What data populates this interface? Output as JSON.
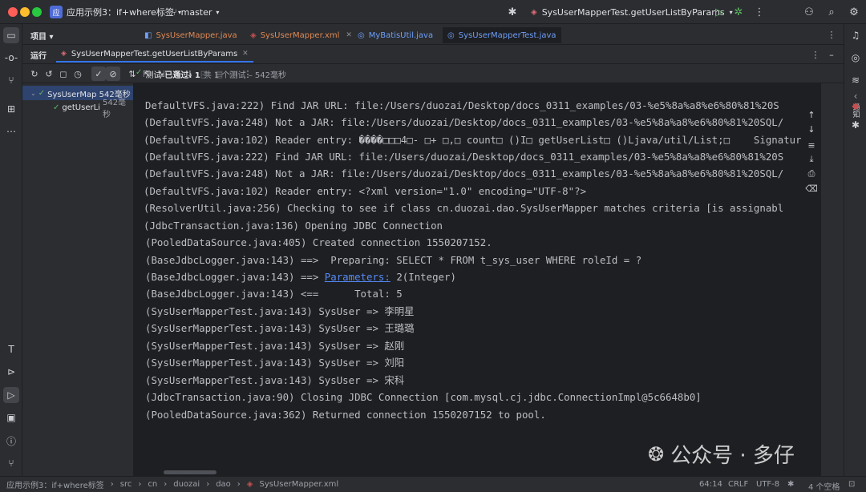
{
  "titlebar": {
    "project_badge": "应",
    "project": "应用示例3：if+where标签",
    "branch": "master",
    "run_config": "SysUserMapperTest.getUserListByParams"
  },
  "editor_tabs": {
    "project_label": "项目",
    "tabs": [
      {
        "label": "SysUserMapper.java",
        "color": "#e08855"
      },
      {
        "label": "SysUserMapper.xml",
        "color": "#e08855"
      },
      {
        "label": "MyBatisUtil.java",
        "color": "#6f9ef8"
      },
      {
        "label": "SysUserMapperTest.java",
        "color": "#6f9ef8"
      }
    ]
  },
  "run_panel": {
    "label": "运行",
    "tab": "SysUserMapperTest.getUserListByParams",
    "status_prefix": "测试",
    "status_passed": "已通过: 1",
    "status_detail": "共 1 个测试 – 542毫秒"
  },
  "tree": [
    {
      "label": "SysUserMap 542毫秒",
      "level": 0
    },
    {
      "label": "getUserLi",
      "time": "542毫秒",
      "level": 1
    }
  ],
  "console_lines": [
    "DefaultVFS.java:222) Find JAR URL: file:/Users/duozai/Desktop/docs_0311_examples/03-%e5%8a%a8%e6%80%81%20S",
    "(DefaultVFS.java:248) Not a JAR: file:/Users/duozai/Desktop/docs_0311_examples/03-%e5%8a%a8%e6%80%81%20SQL/",
    "(DefaultVFS.java:102) Reader entry: ����□□□4□- □+ □,□ count□ ()I□ getUserList□ ()Ljava/util/List;□    Signatur",
    "(DefaultVFS.java:222) Find JAR URL: file:/Users/duozai/Desktop/docs_0311_examples/03-%e5%8a%a8%e6%80%81%20S",
    "(DefaultVFS.java:248) Not a JAR: file:/Users/duozai/Desktop/docs_0311_examples/03-%e5%8a%a8%e6%80%81%20SQL/",
    "(DefaultVFS.java:102) Reader entry: <?xml version=\"1.0\" encoding=\"UTF-8\"?>",
    "(ResolverUtil.java:256) Checking to see if class cn.duozai.dao.SysUserMapper matches criteria [is assignabl",
    "(JdbcTransaction.java:136) Opening JDBC Connection",
    "(PooledDataSource.java:405) Created connection 1550207152.",
    "(BaseJdbcLogger.java:143) ==>  Preparing: SELECT * FROM t_sys_user WHERE roleId = ?",
    "(BaseJdbcLogger.java:143) ==> ",
    "(BaseJdbcLogger.java:143) <==      Total: 5",
    "(SysUserMapperTest.java:143) SysUser => 李明星",
    "(SysUserMapperTest.java:143) SysUser => 王璐璐",
    "(SysUserMapperTest.java:143) SysUser => 赵刚",
    "(SysUserMapperTest.java:143) SysUser => 刘阳",
    "(SysUserMapperTest.java:143) SysUser => 宋科",
    "(JdbcTransaction.java:90) Closing JDBC Connection [com.mysql.cj.jdbc.ConnectionImpl@5c6648b0]",
    "(PooledDataSource.java:362) Returned connection 1550207152 to pool."
  ],
  "params_link": "Parameters:",
  "params_value": " 2(Integer)",
  "statusbar": {
    "crumbs": [
      "应用示例3：if+where标签",
      "src",
      "cn",
      "duozai",
      "dao",
      "SysUserMapper.xml"
    ],
    "position": "64:14",
    "line_sep": "CRLF",
    "encoding": "UTF-8",
    "indent": "4 个空格"
  },
  "watermark": "公众号 · 多仔",
  "right_panel_label": "通知"
}
